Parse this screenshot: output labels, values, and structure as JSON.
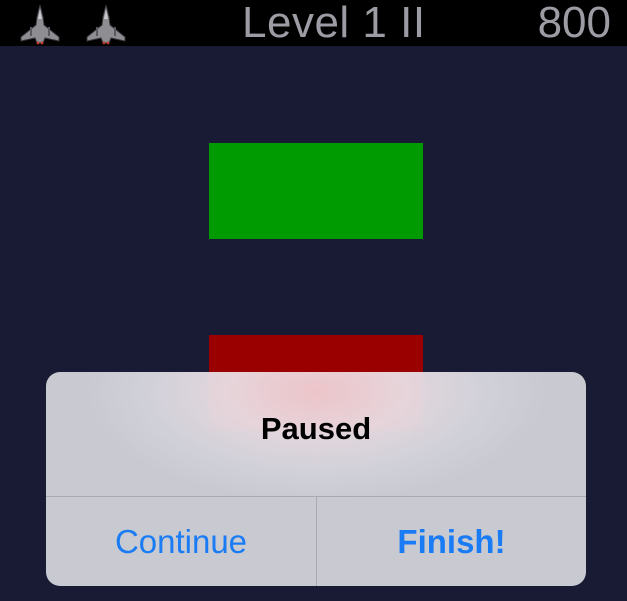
{
  "hud": {
    "lives_icon": "fighter-jet-icon",
    "lives_remaining": 2,
    "level_title": "Level 1 II",
    "score": "800"
  },
  "blocks": {
    "green_color": "#009b00",
    "red_color": "#9b0000"
  },
  "pause_dialog": {
    "title": "Paused",
    "continue_label": "Continue",
    "finish_label": "Finish!",
    "button_color": "#1a7cf5"
  }
}
